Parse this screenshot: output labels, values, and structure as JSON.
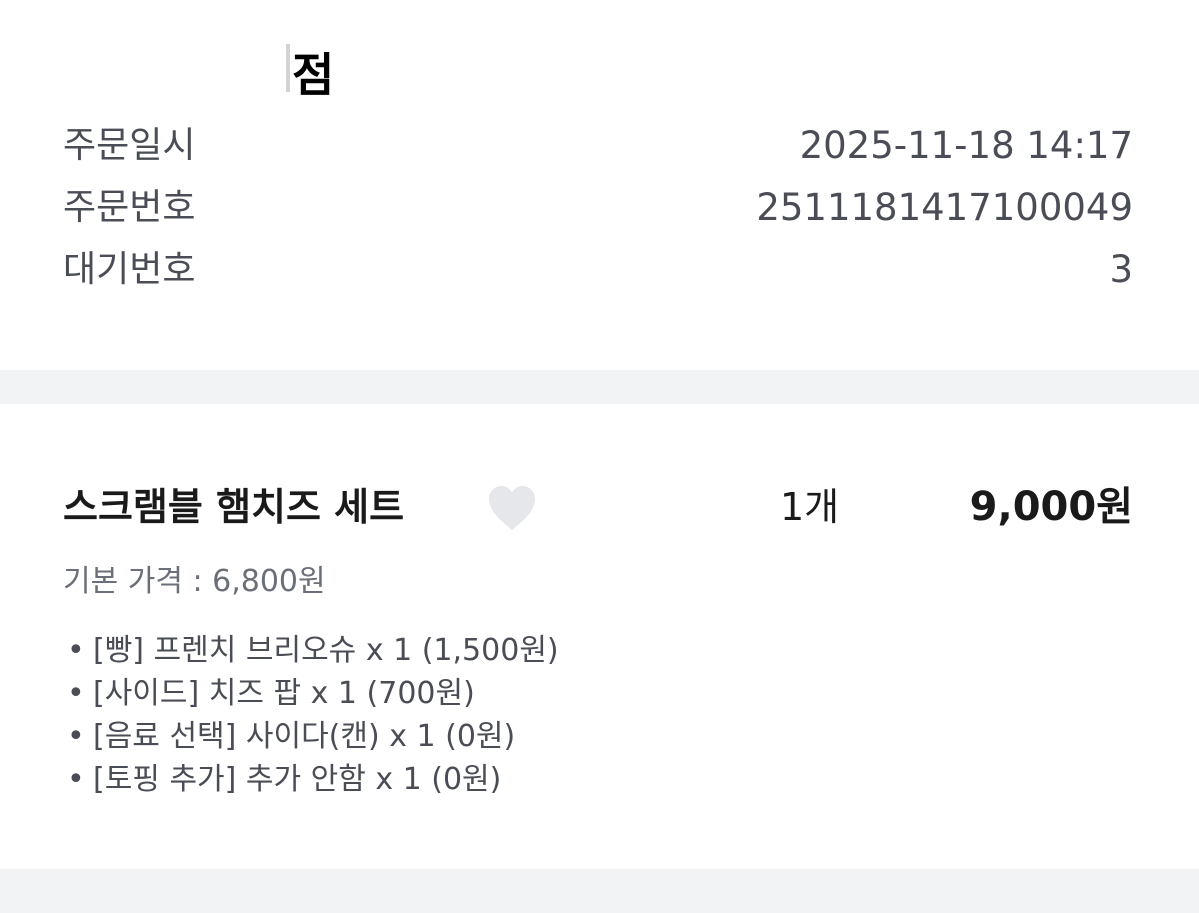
{
  "store": {
    "name": "점"
  },
  "info": {
    "rows": [
      {
        "label": "주문일시",
        "value": "2025-11-18 14:17"
      },
      {
        "label": "주문번호",
        "value": "2511181417100049"
      },
      {
        "label": "대기번호",
        "value": "3"
      }
    ]
  },
  "item": {
    "name": "스크램블 햄치즈 세트",
    "favorite_icon": "heart-icon",
    "quantity": "1개",
    "price": "9,000원",
    "base_price": "기본 가격 : 6,800원",
    "options": [
      "[빵] 프렌치 브리오슈 x 1 (1,500원)",
      "[사이드] 치즈 팝 x 1 (700원)",
      "[음료 선택] 사이다(캔) x 1 (0원)",
      "[토핑 추가] 추가 안함 x 1 (0원)"
    ]
  },
  "colors": {
    "divider": "#f2f3f5",
    "label": "#4a4d55",
    "heart": "#e6e7ea"
  }
}
